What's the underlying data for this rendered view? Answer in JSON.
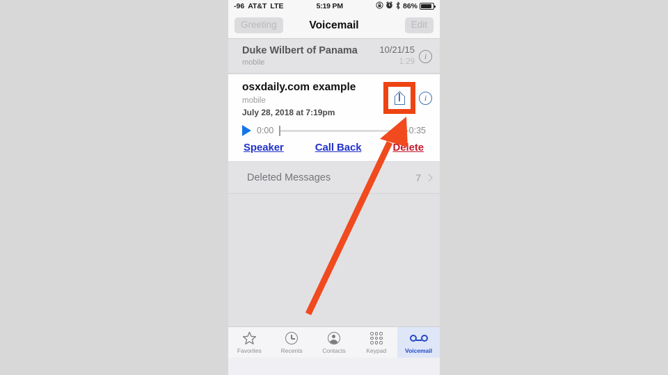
{
  "status_bar": {
    "signal": "-96",
    "carrier": "AT&T",
    "network": "LTE",
    "time": "5:19 PM",
    "battery_pct": "86%",
    "icons": [
      "rotation-lock-icon",
      "alarm-icon",
      "bluetooth-icon",
      "battery-icon"
    ]
  },
  "nav": {
    "left_button": "Greeting",
    "title": "Voicemail",
    "right_button": "Edit"
  },
  "voicemails": [
    {
      "name": "Duke Wilbert of Panama",
      "label": "mobile",
      "date": "10/21/15",
      "duration": "1:29",
      "expanded": false
    }
  ],
  "expanded_voicemail": {
    "name": "osxdaily.com example",
    "label": "mobile",
    "timestamp": "July 28, 2018 at 7:19pm",
    "share_icon": "share-icon",
    "info_icon": "info-icon",
    "player": {
      "current_time": "0:00",
      "remaining_time": "-0:35",
      "progress_pct": 0,
      "play_icon": "play-icon"
    },
    "actions": [
      {
        "label": "Speaker",
        "style": "link"
      },
      {
        "label": "Call Back",
        "style": "link"
      },
      {
        "label": "Delete",
        "style": "danger"
      }
    ]
  },
  "deleted_messages": {
    "label": "Deleted Messages",
    "count": "7",
    "chevron": "chevron-right-icon"
  },
  "tabs": [
    {
      "label": "Favorites",
      "icon": "star-icon",
      "active": false
    },
    {
      "label": "Recents",
      "icon": "clock-icon",
      "active": false
    },
    {
      "label": "Contacts",
      "icon": "person-icon",
      "active": false
    },
    {
      "label": "Keypad",
      "icon": "keypad-icon",
      "active": false
    },
    {
      "label": "Voicemail",
      "icon": "voicemail-icon",
      "active": true
    }
  ],
  "annotation": {
    "highlight_color": "#ee4413",
    "arrow_color": "#f04a1e",
    "target": "share-icon"
  },
  "colors": {
    "accent_blue": "#1575e8",
    "link_blue": "#2232c8",
    "danger_red": "#c21b2e",
    "tab_active": "#2449c8",
    "canvas_gray": "#d8d8d8"
  }
}
